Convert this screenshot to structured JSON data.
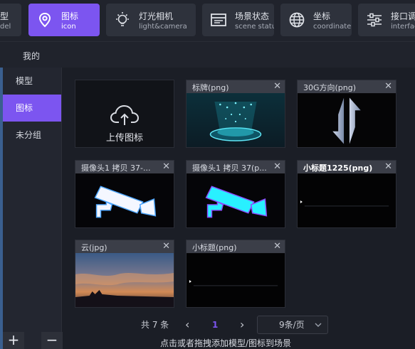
{
  "toolbar": {
    "items": [
      {
        "title": "型",
        "subtitle": "del"
      },
      {
        "title": "图标",
        "subtitle": "icon"
      },
      {
        "title": "灯光相机",
        "subtitle": "light&camera"
      },
      {
        "title": "场景状态",
        "subtitle": "scene status"
      },
      {
        "title": "坐标",
        "subtitle": "coordinate"
      },
      {
        "title": "接口调试",
        "subtitle": "interface d"
      }
    ],
    "active_color": "#7c55f0"
  },
  "tab": {
    "label": "我的"
  },
  "sidebar": {
    "items": [
      {
        "label": "模型"
      },
      {
        "label": "图标"
      },
      {
        "label": "未分组"
      }
    ],
    "add_label": "+",
    "remove_label": "−"
  },
  "upload": {
    "label": "上传图标"
  },
  "cards": [
    {
      "name": "标牌(png)"
    },
    {
      "name": "30G方向(png)"
    },
    {
      "name": "摄像头1 拷贝 37-..."
    },
    {
      "name": "摄像头1 拷贝 37(p..."
    },
    {
      "name": "小标题1225(png)"
    },
    {
      "name": "云(jpg)"
    },
    {
      "name": "小标题(png)"
    }
  ],
  "close_glyph": "✕",
  "pagination": {
    "total": "共 7 条",
    "prev": "‹",
    "current": "1",
    "next": "›",
    "page_size": "9条/页"
  },
  "hint": "点击或者拖拽添加模型/图标到场景"
}
